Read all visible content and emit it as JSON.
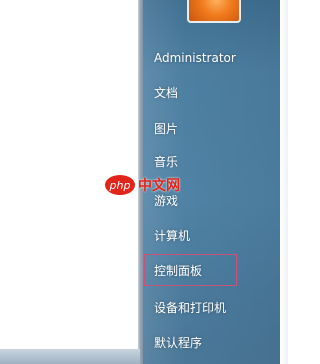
{
  "right_column": {
    "user_name": "Administrator",
    "items": [
      "文档",
      "图片",
      "音乐",
      "游戏",
      "计算机",
      "控制面板",
      "设备和打印机",
      "默认程序"
    ],
    "highlighted_item": "控制面板"
  },
  "watermark": {
    "logo": "php",
    "text": "中文网",
    "color": "#e1251b"
  },
  "colors": {
    "panel_blue": "#4f82a5",
    "highlight_border": "#c7537a",
    "user_picture": "#f07a1c"
  }
}
